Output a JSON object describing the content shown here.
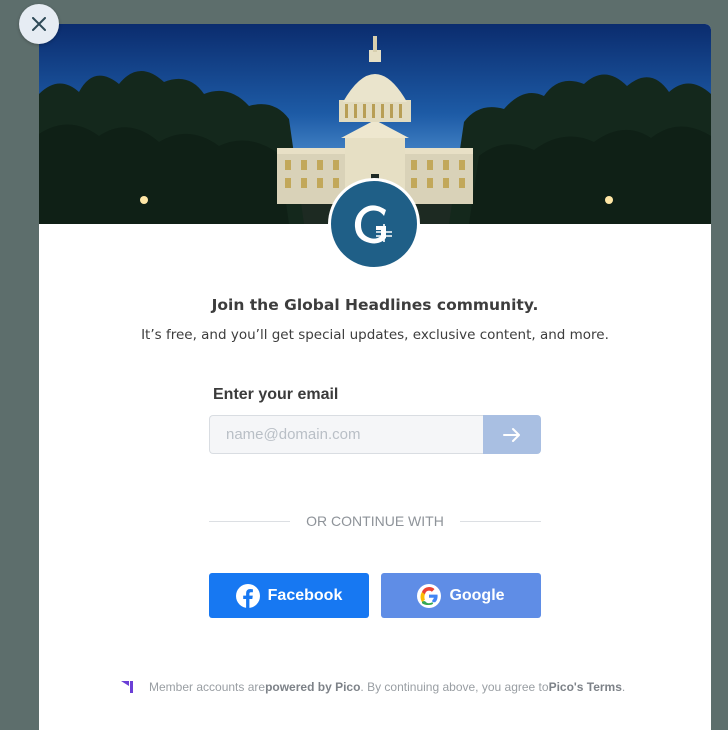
{
  "close": {
    "icon": "close-icon"
  },
  "hero": {
    "image_description_icon": "capitol-photo"
  },
  "logo": {
    "icon": "global-headlines-logo-icon"
  },
  "title": "Join the Global Headlines community.",
  "subtitle": "It’s free, and you’ll get special updates, exclusive content, and more.",
  "email": {
    "label": "Enter your email",
    "placeholder": "name@domain.com",
    "value": "",
    "submit_icon": "arrow-right-icon"
  },
  "divider_text": "OR CONTINUE WITH",
  "social": {
    "facebook_label": "Facebook",
    "google_label": "Google"
  },
  "footer": {
    "prefix": "Member accounts are ",
    "powered": "powered by Pico",
    "middle": ". By continuing above, you agree to ",
    "terms": "Pico's Terms",
    "suffix": "."
  },
  "colors": {
    "facebook": "#1778f2",
    "google_button": "#5f8de6",
    "submit_button": "#a9bfe2",
    "logo_bg": "#1f5f87",
    "pico_purple": "#6b3fd6"
  }
}
